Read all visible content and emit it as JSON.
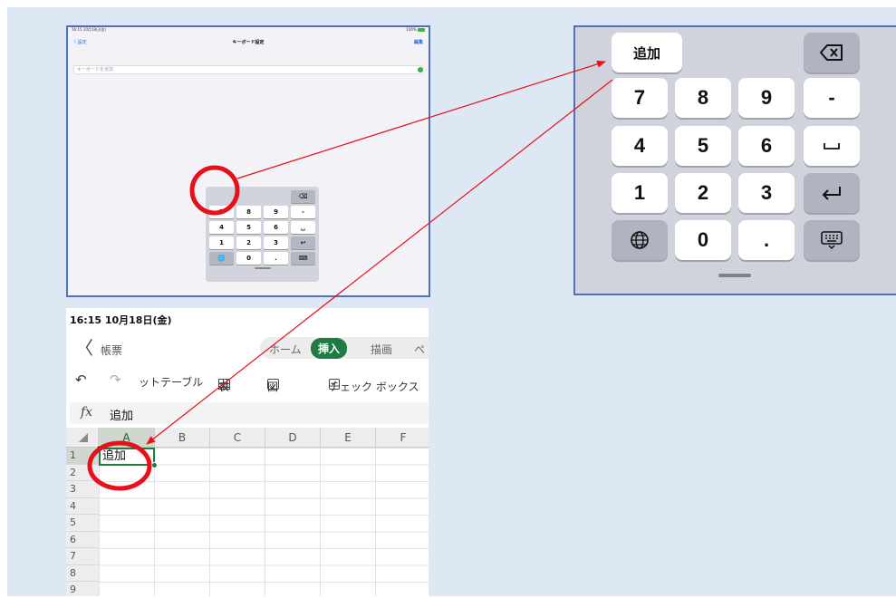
{
  "ipad_screen": {
    "status_left": "16:15  10月18日(金)",
    "status_right": "100%",
    "nav_back": "〈 設定",
    "nav_title": "キーボード設定",
    "nav_done": "編集",
    "field_placeholder": "キーボードを追加",
    "mini_keyboard": {
      "rows": [
        [
          "",
          "",
          "",
          "⌫"
        ],
        [
          "7",
          "8",
          "9",
          "-"
        ],
        [
          "4",
          "5",
          "6",
          "␣"
        ],
        [
          "1",
          "2",
          "3",
          "↩"
        ],
        [
          "🌐",
          "0",
          ".",
          "⌨"
        ]
      ]
    }
  },
  "zoom_keyboard": {
    "add_key": "追加",
    "delete_key_icon": "⌫",
    "keys": {
      "k7": "7",
      "k8": "8",
      "k9": "9",
      "minus": "-",
      "k4": "4",
      "k5": "5",
      "k6": "6",
      "space": "␣",
      "k1": "1",
      "k2": "2",
      "k3": "3",
      "enter": "↩",
      "globe": "🌐",
      "k0": "0",
      "dot": ".",
      "hide": "⌨"
    }
  },
  "excel": {
    "status_time": "16:15  10月18日(金)",
    "back_icon": "〈",
    "doc_name": "帳票",
    "tabs": [
      {
        "label": "ホーム"
      },
      {
        "label": "挿入"
      },
      {
        "label": "描画"
      },
      {
        "label": "ペ"
      }
    ],
    "ribbon": {
      "pivot": "ットテーブル",
      "table": "表",
      "picture": "図",
      "checkbox": "チェック ボックス"
    },
    "formula_bar": {
      "fx": "fx",
      "value": "追加"
    },
    "columns": [
      "A",
      "B",
      "C",
      "D",
      "E",
      "F"
    ],
    "rows": [
      "1",
      "2",
      "3",
      "4",
      "5",
      "6",
      "7",
      "8",
      "9"
    ],
    "cell_a1": "追加"
  },
  "colors": {
    "annotation_red": "#e8101a",
    "excel_green": "#1e7b43",
    "frame_blue": "#5270b8"
  }
}
